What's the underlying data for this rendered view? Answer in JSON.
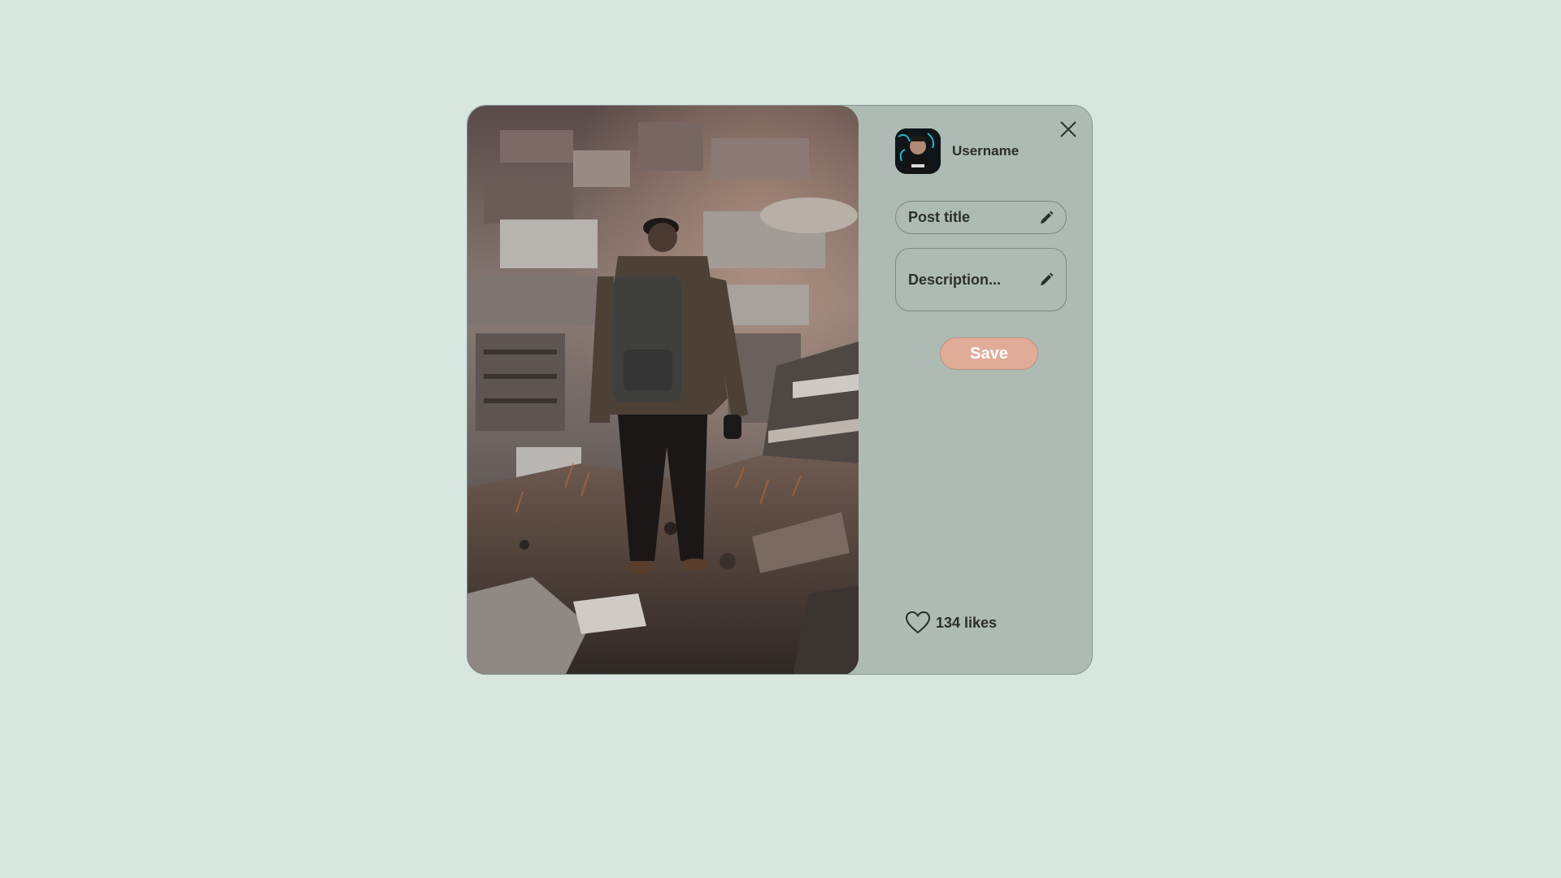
{
  "post": {
    "username": "Username",
    "title_placeholder": "Post title",
    "description_placeholder": "Description...",
    "save_label": "Save",
    "likes": "134 likes"
  },
  "icons": {
    "close": "close-icon",
    "edit": "pencil-icon",
    "like": "heart-icon"
  },
  "colors": {
    "background": "#d7e6df",
    "card": "#aebbb3",
    "save_button": "#e0ac98"
  }
}
